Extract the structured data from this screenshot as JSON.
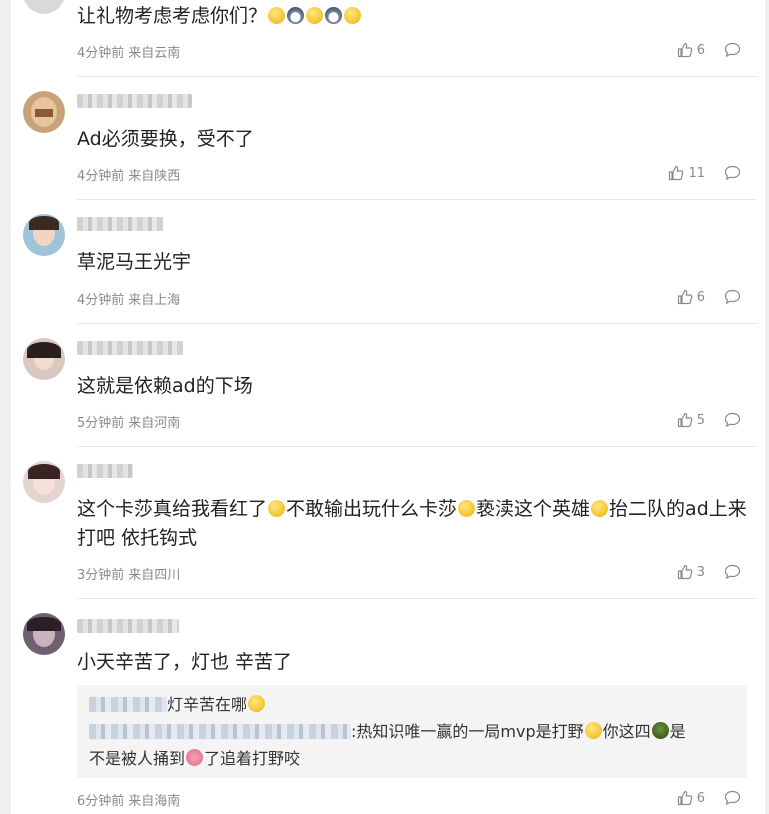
{
  "colors": {
    "meta": "#8a8a8a",
    "text": "#222222",
    "background": "#f0f0f0",
    "card": "#ffffff"
  },
  "icons": {
    "like": "thumbs-up-icon",
    "reply": "comment-bubble-icon",
    "emoji": "smile-emoji-icon"
  },
  "comments": [
    {
      "text_parts": [
        "让礼物考虑考虑你们？"
      ],
      "time": "4分钟前",
      "location": "来自云南",
      "likes": "6"
    },
    {
      "text_parts": [
        "Ad必须要换，受不了"
      ],
      "time": "4分钟前",
      "location": "来自陕西",
      "likes": "11"
    },
    {
      "text_parts": [
        "草泥马王光宇"
      ],
      "time": "4分钟前",
      "location": "来自上海",
      "likes": "6"
    },
    {
      "text_parts": [
        "这就是依赖ad的下场"
      ],
      "time": "5分钟前",
      "location": "来自河南",
      "likes": "5"
    },
    {
      "text_parts": [
        "这个卡莎真给我看红了",
        "不敢输出玩什么卡莎",
        "亵渎这个英雄",
        "抬二队的ad上来打吧 依托钩式"
      ],
      "time": "3分钟前",
      "location": "来自四川",
      "likes": "3"
    },
    {
      "text_parts": [
        "小天辛苦了，灯也 辛苦了"
      ],
      "quote": {
        "line1": "灯辛苦在哪",
        "line2a": ":热知识唯一赢的一局mvp是打野",
        "line2b": "你这四",
        "line2c": "是",
        "line3a": "不是被人捅到",
        "line3b": "了追着打野咬"
      },
      "time": "6分钟前",
      "location": "来自海南",
      "likes": "6"
    }
  ]
}
